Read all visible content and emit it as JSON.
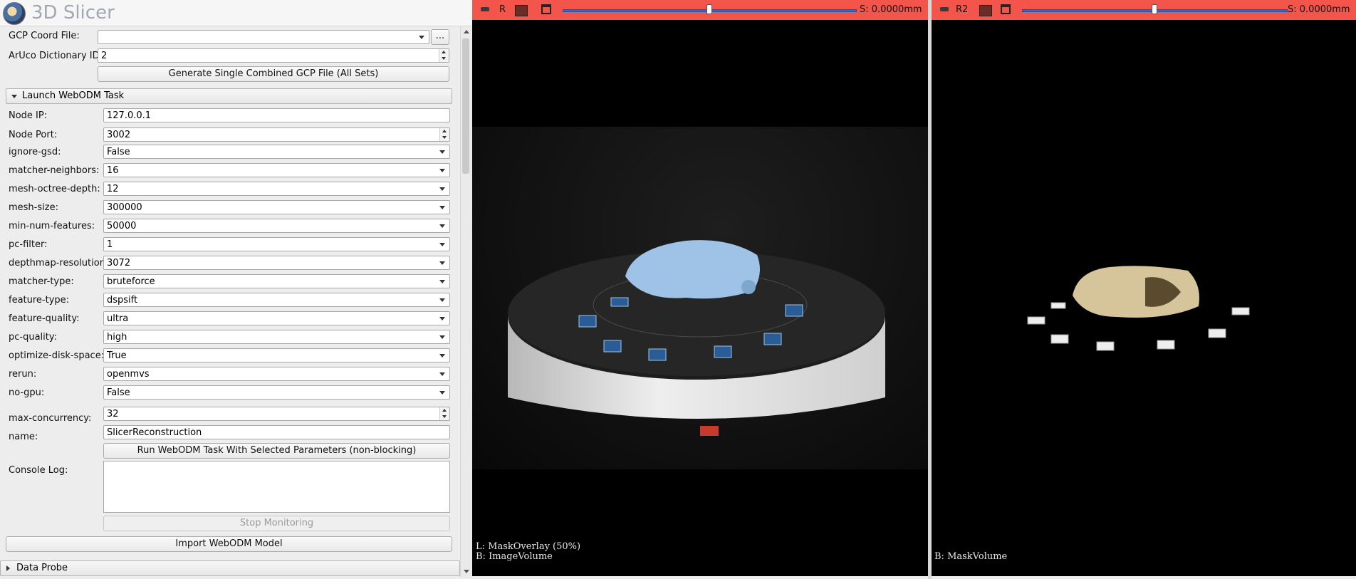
{
  "app": {
    "title": "3D Slicer"
  },
  "gcp": {
    "coord_file_label": "GCP Coord File:",
    "coord_file_value": "",
    "browse_label": "...",
    "aruco_label": "ArUco Dictionary ID:",
    "aruco_value": "2",
    "generate_button": "Generate Single Combined GCP File (All Sets)"
  },
  "launch_section": {
    "title": "Launch WebODM Task",
    "node_ip_label": "Node IP:",
    "node_ip_value": "127.0.0.1",
    "node_port_label": "Node Port:",
    "node_port_value": "3002",
    "params": [
      {
        "label": "ignore-gsd:",
        "value": "False"
      },
      {
        "label": "matcher-neighbors:",
        "value": "16"
      },
      {
        "label": "mesh-octree-depth:",
        "value": "12"
      },
      {
        "label": "mesh-size:",
        "value": "300000"
      },
      {
        "label": "min-num-features:",
        "value": "50000"
      },
      {
        "label": "pc-filter:",
        "value": "1"
      },
      {
        "label": "depthmap-resolution:",
        "value": "3072"
      },
      {
        "label": "matcher-type:",
        "value": "bruteforce"
      },
      {
        "label": "feature-type:",
        "value": "dspsift"
      },
      {
        "label": "feature-quality:",
        "value": "ultra"
      },
      {
        "label": "pc-quality:",
        "value": "high"
      },
      {
        "label": "optimize-disk-space:",
        "value": "True"
      },
      {
        "label": "rerun:",
        "value": "openmvs"
      },
      {
        "label": "no-gpu:",
        "value": "False"
      }
    ],
    "max_concurrency_label": "max-concurrency:",
    "max_concurrency_value": "32",
    "name_label": "name:",
    "name_value": "SlicerReconstruction",
    "run_button": "Run WebODM Task With Selected Parameters (non-blocking)",
    "console_label": "Console Log:",
    "console_value": "",
    "stop_button": "Stop Monitoring",
    "import_button": "Import WebODM Model"
  },
  "data_probe": {
    "title": "Data Probe"
  },
  "viewer_r": {
    "name": "R",
    "offset": "S: 0.0000mm",
    "slider_fraction": 0.5,
    "bottom_left_1": "L: MaskOverlay (50%)",
    "bottom_left_2": "B: ImageVolume"
  },
  "viewer_r2": {
    "name": "R2",
    "offset": "S: 0.0000mm",
    "slider_fraction": 0.5,
    "bottom_left_1": "B: MaskVolume"
  },
  "colors": {
    "slice_bar": "#f3554a",
    "slider_blue": "#2f6fd1",
    "skull_blue": "#9fc3e6",
    "skull_bone": "#d6c59b"
  }
}
